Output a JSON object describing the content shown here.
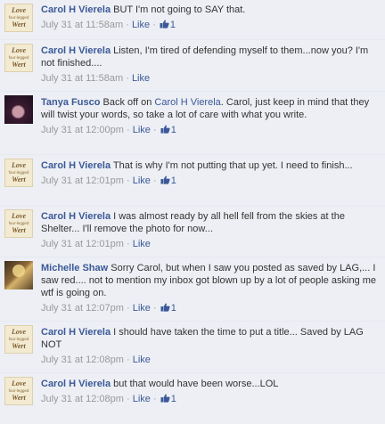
{
  "comments": [
    {
      "author": "Carol H Vierela",
      "avatar": "logo-icon",
      "text": "BUT I'm not going to SAY that.",
      "time": "July 31 at 11:58am",
      "like_label": "Like",
      "like_count": "1"
    },
    {
      "author": "Carol H Vierela",
      "avatar": "logo-icon",
      "text": "Listen, I'm tired of defending myself to them...now you? I'm not finished....",
      "time": "July 31 at 11:58am",
      "like_label": "Like"
    },
    {
      "author": "Tanya Fusco",
      "avatar": "profile-photo",
      "text_pre": "Back off on ",
      "mention": "Carol H Vierela",
      "text_post": ". Carol, just keep in mind that they will twist your words, so take a lot of care with what you write.",
      "time": "July 31 at 12:00pm",
      "like_label": "Like",
      "like_count": "1"
    },
    {
      "author": "Carol H Vierela",
      "avatar": "logo-icon",
      "text": "That is why I'm not putting that up yet. I need to finish...",
      "time": "July 31 at 12:01pm",
      "like_label": "Like",
      "like_count": "1"
    },
    {
      "author": "Carol H Vierela",
      "avatar": "logo-icon",
      "text": "I was almost ready by all hell fell from the skies at the Shelter... I'll remove the photo for now...",
      "time": "July 31 at 12:01pm",
      "like_label": "Like"
    },
    {
      "author": "Michelle Shaw",
      "avatar": "profile-photo",
      "text": "Sorry Carol, but when I saw you posted as saved by LAG,... I saw red.... not to mention my inbox got blown up by a lot of people asking me wtf is going on.",
      "time": "July 31 at 12:07pm",
      "like_label": "Like",
      "like_count": "1"
    },
    {
      "author": "Carol H Vierela",
      "avatar": "logo-icon",
      "text": "I should have taken the time to put a title... Saved by LAG NOT",
      "time": "July 31 at 12:08pm",
      "like_label": "Like"
    },
    {
      "author": "Carol H Vierela",
      "avatar": "logo-icon",
      "text": "but that would have been worse...LOL",
      "time": "July 31 at 12:08pm",
      "like_label": "Like",
      "like_count": "1"
    }
  ],
  "logo_text": [
    "Love",
    "four-legged",
    "Wert"
  ],
  "separator": "·",
  "colors": {
    "link": "#3b5998",
    "meta": "#999999",
    "comment_bg": "#edeff4",
    "text": "#333333"
  }
}
